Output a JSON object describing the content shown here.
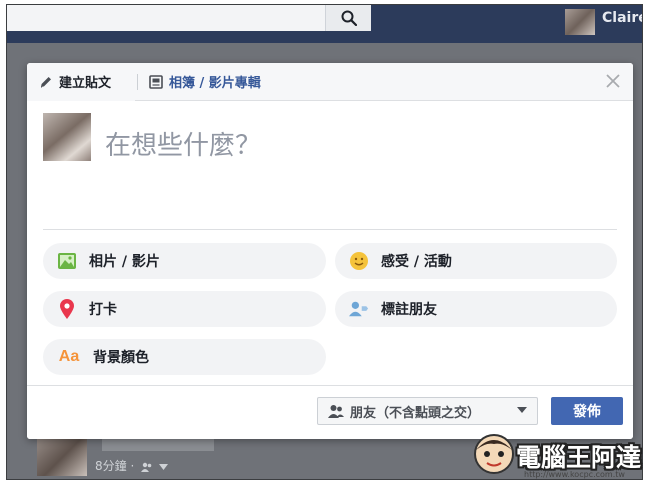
{
  "topbar": {
    "username": "Claire",
    "search_icon": "search-icon"
  },
  "modal": {
    "tabs": {
      "create_post": "建立貼文",
      "photo_video_album": "相簿 / 影片專輯"
    },
    "composer_placeholder": "在想些什麼？",
    "options": [
      {
        "label": "相片 / 影片",
        "icon": "photo-icon"
      },
      {
        "label": "感受 / 活動",
        "icon": "smiley-icon"
      },
      {
        "label": "打卡",
        "icon": "location-pin-icon"
      },
      {
        "label": "標註朋友",
        "icon": "tag-friends-icon"
      },
      {
        "label": "背景顏色",
        "icon": "text-aa-icon"
      }
    ],
    "footer": {
      "audience": "朋友（不含點頭之交）",
      "post_button": "發佈"
    }
  },
  "feed": {
    "timestamp": "8分鐘 ·"
  },
  "watermark": {
    "text": "電腦王阿達",
    "url": "http://www.kocpc.com.tw"
  },
  "colors": {
    "accent": "#4267b2",
    "link": "#365899",
    "topbar": "#2c3b5b",
    "overlay": "#6f7278"
  }
}
